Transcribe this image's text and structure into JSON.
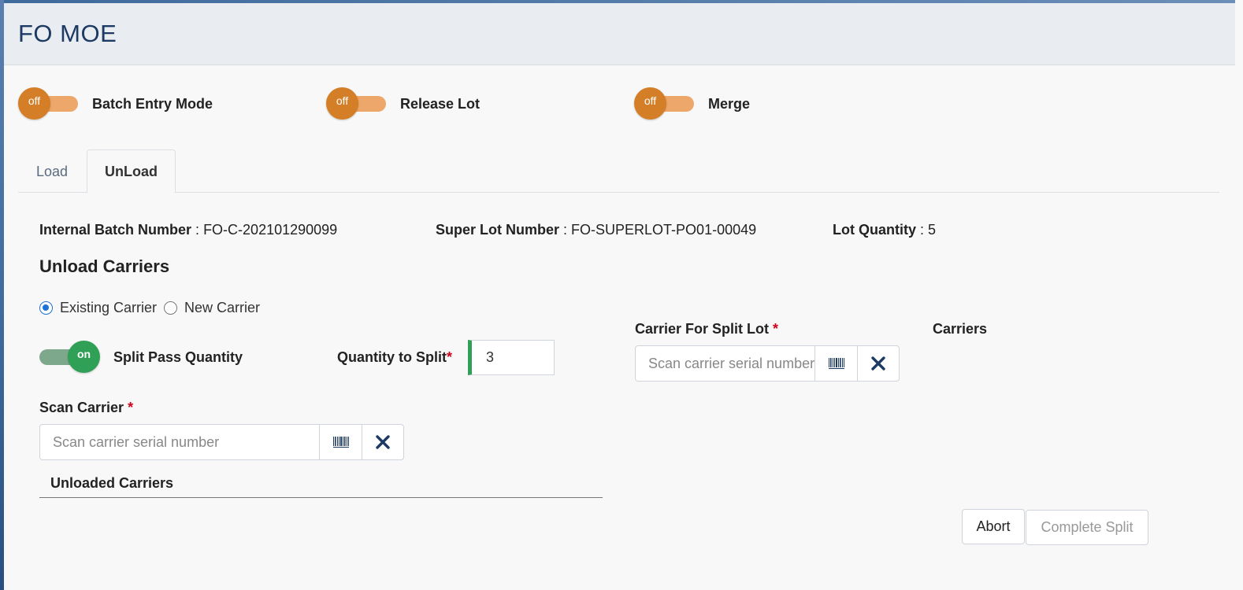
{
  "app": {
    "title": "FO MOE"
  },
  "mode_toggles": [
    {
      "label": "Batch Entry Mode",
      "state": "off"
    },
    {
      "label": "Release Lot",
      "state": "off"
    },
    {
      "label": "Merge",
      "state": "off"
    }
  ],
  "tabs": [
    {
      "label": "Load",
      "active": false
    },
    {
      "label": "UnLoad",
      "active": true
    }
  ],
  "info": {
    "internal_batch_label": "Internal Batch Number",
    "internal_batch_value": "FO-C-202101290099",
    "super_lot_label": "Super Lot Number",
    "super_lot_value": "FO-SUPERLOT-PO01-00049",
    "lot_quantity_label": "Lot Quantity",
    "lot_quantity_value": "5",
    "separator": " : "
  },
  "unload": {
    "section_title": "Unload Carriers",
    "radio_options": [
      {
        "label": "Existing Carrier",
        "checked": true
      },
      {
        "label": "New Carrier",
        "checked": false
      }
    ],
    "split_toggle": {
      "label": "Split Pass Quantity",
      "state": "on"
    },
    "quantity_to_split": {
      "label": "Quantity to Split",
      "required_mark": "*",
      "value": "3"
    },
    "scan_carrier": {
      "label": "Scan Carrier",
      "required_mark": "*",
      "placeholder": "Scan carrier serial number"
    },
    "unloaded_carriers_title": "Unloaded Carriers"
  },
  "split_lot": {
    "label": "Carrier For Split Lot",
    "required_mark": "*",
    "placeholder": "Scan carrier serial number",
    "carriers_label": "Carriers"
  },
  "actions": {
    "abort_label": "Abort",
    "complete_split_label": "Complete Split"
  },
  "icons": {
    "barcode": "barcode-icon",
    "clear": "close-icon"
  },
  "colors": {
    "toggle_off_knob": "#d47f27",
    "toggle_off_track": "#eea76a",
    "toggle_on_knob": "#2fa055",
    "toggle_on_track": "#7ea88c",
    "header_text": "#1c3a63",
    "clear_icon": "#1c3a63",
    "required": "#d0021b"
  }
}
